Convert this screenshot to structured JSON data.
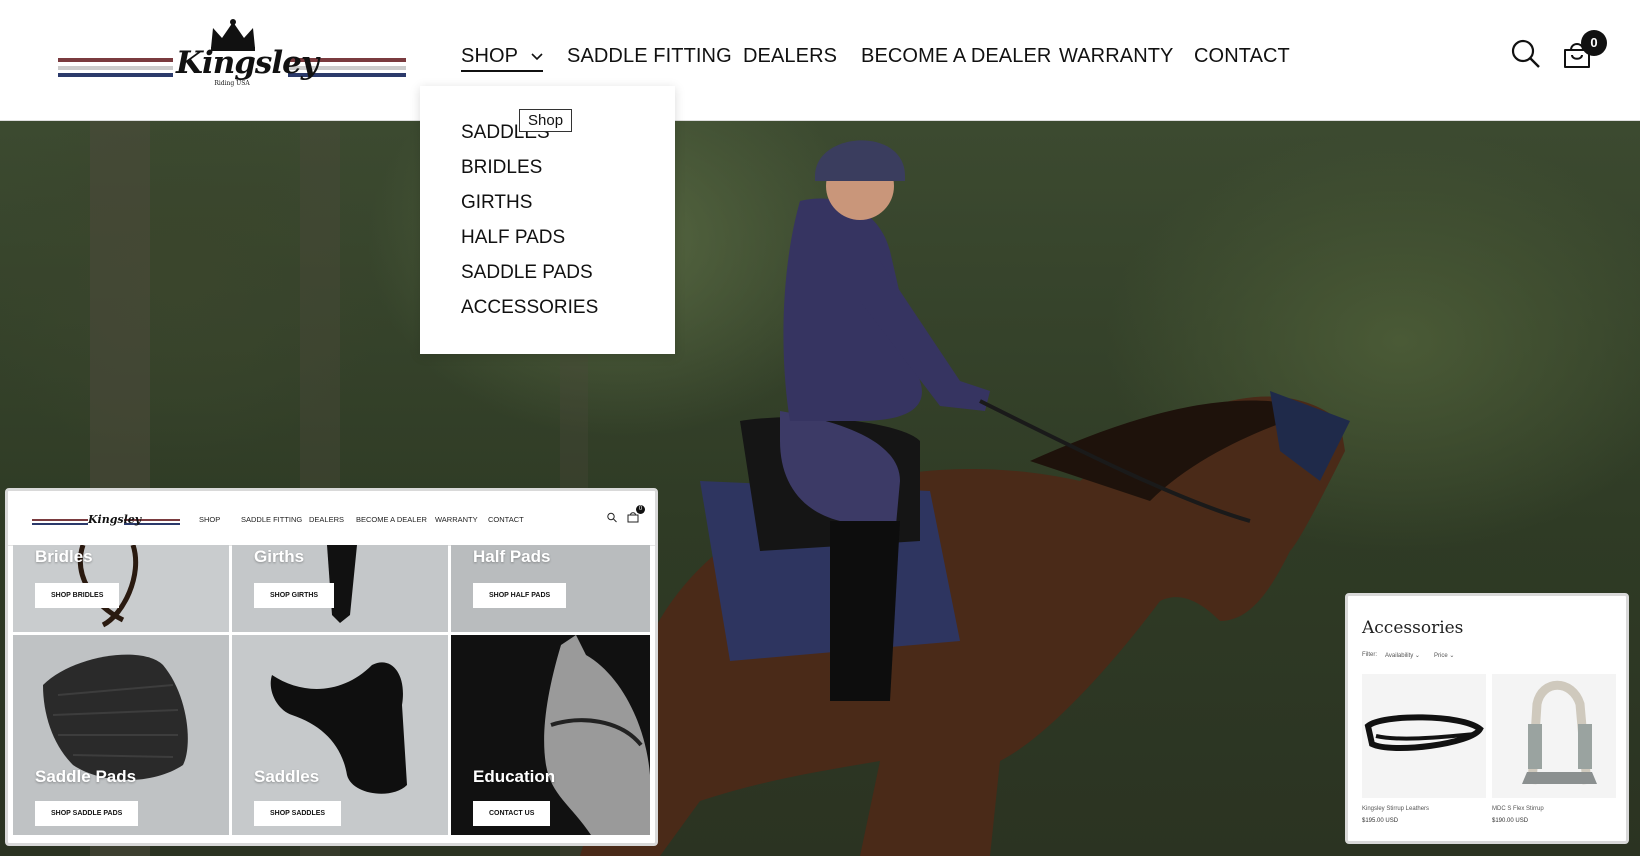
{
  "brand": {
    "name": "Kingsley",
    "tagline": "Riding USA",
    "stripe_red": "#7a3b3f",
    "stripe_blue": "#2b3a6b"
  },
  "nav": {
    "items": [
      {
        "label": "SHOP",
        "active": true,
        "has_dropdown": true
      },
      {
        "label": "SADDLE FITTING"
      },
      {
        "label": "DEALERS"
      },
      {
        "label": "BECOME A DEALER"
      },
      {
        "label": "WARRANTY"
      },
      {
        "label": "CONTACT"
      }
    ],
    "search_icon": "search-icon",
    "cart_icon": "bag-icon",
    "cart_count": "0"
  },
  "dropdown": {
    "items": [
      "SADDLES",
      "BRIDLES",
      "GIRTHS",
      "HALF PADS",
      "SADDLE PADS",
      "ACCESSORIES"
    ]
  },
  "tooltip": "Shop",
  "thumb_left": {
    "nav": [
      "SHOP",
      "SADDLE FITTING",
      "DEALERS",
      "BECOME A DEALER",
      "WARRANTY",
      "CONTACT"
    ],
    "cart_count": "0",
    "tiles": [
      {
        "title": "Bridles",
        "button": "SHOP BRIDLES"
      },
      {
        "title": "Girths",
        "button": "SHOP GIRTHS"
      },
      {
        "title": "Half Pads",
        "button": "SHOP HALF PADS"
      },
      {
        "title": "Saddle Pads",
        "button": "SHOP SADDLE PADS"
      },
      {
        "title": "Saddles",
        "button": "SHOP SADDLES"
      },
      {
        "title": "Education",
        "button": "CONTACT US"
      }
    ]
  },
  "thumb_right": {
    "title": "Accessories",
    "filter_label": "Filter:",
    "availability": "Availability",
    "price": "Price",
    "products": [
      {
        "name": "Kingsley Stirrup Leathers",
        "price": "$195.00 USD"
      },
      {
        "name": "MDC S Flex Stirrup",
        "price": "$190.00 USD"
      }
    ]
  }
}
